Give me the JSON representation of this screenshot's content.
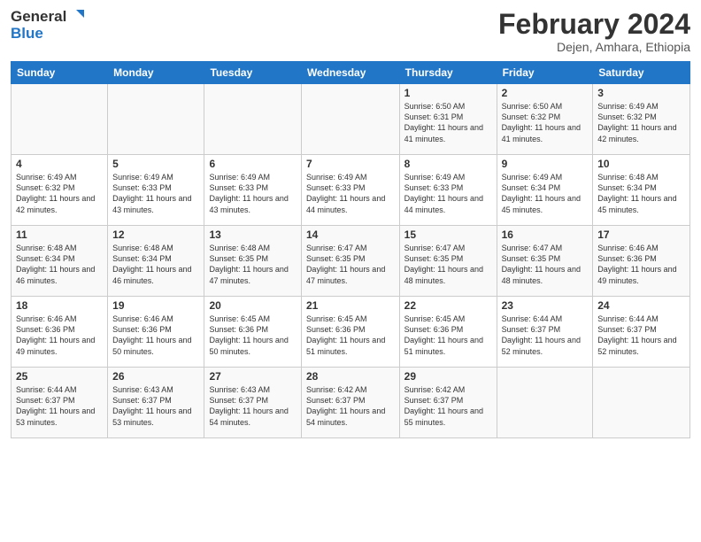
{
  "header": {
    "logo": {
      "general": "General",
      "blue": "Blue"
    },
    "month_year": "February 2024",
    "location": "Dejen, Amhara, Ethiopia"
  },
  "days_of_week": [
    "Sunday",
    "Monday",
    "Tuesday",
    "Wednesday",
    "Thursday",
    "Friday",
    "Saturday"
  ],
  "weeks": [
    [
      {
        "day": "",
        "info": ""
      },
      {
        "day": "",
        "info": ""
      },
      {
        "day": "",
        "info": ""
      },
      {
        "day": "",
        "info": ""
      },
      {
        "day": "1",
        "info": "Sunrise: 6:50 AM\nSunset: 6:31 PM\nDaylight: 11 hours and 41 minutes."
      },
      {
        "day": "2",
        "info": "Sunrise: 6:50 AM\nSunset: 6:32 PM\nDaylight: 11 hours and 41 minutes."
      },
      {
        "day": "3",
        "info": "Sunrise: 6:49 AM\nSunset: 6:32 PM\nDaylight: 11 hours and 42 minutes."
      }
    ],
    [
      {
        "day": "4",
        "info": "Sunrise: 6:49 AM\nSunset: 6:32 PM\nDaylight: 11 hours and 42 minutes."
      },
      {
        "day": "5",
        "info": "Sunrise: 6:49 AM\nSunset: 6:33 PM\nDaylight: 11 hours and 43 minutes."
      },
      {
        "day": "6",
        "info": "Sunrise: 6:49 AM\nSunset: 6:33 PM\nDaylight: 11 hours and 43 minutes."
      },
      {
        "day": "7",
        "info": "Sunrise: 6:49 AM\nSunset: 6:33 PM\nDaylight: 11 hours and 44 minutes."
      },
      {
        "day": "8",
        "info": "Sunrise: 6:49 AM\nSunset: 6:33 PM\nDaylight: 11 hours and 44 minutes."
      },
      {
        "day": "9",
        "info": "Sunrise: 6:49 AM\nSunset: 6:34 PM\nDaylight: 11 hours and 45 minutes."
      },
      {
        "day": "10",
        "info": "Sunrise: 6:48 AM\nSunset: 6:34 PM\nDaylight: 11 hours and 45 minutes."
      }
    ],
    [
      {
        "day": "11",
        "info": "Sunrise: 6:48 AM\nSunset: 6:34 PM\nDaylight: 11 hours and 46 minutes."
      },
      {
        "day": "12",
        "info": "Sunrise: 6:48 AM\nSunset: 6:34 PM\nDaylight: 11 hours and 46 minutes."
      },
      {
        "day": "13",
        "info": "Sunrise: 6:48 AM\nSunset: 6:35 PM\nDaylight: 11 hours and 47 minutes."
      },
      {
        "day": "14",
        "info": "Sunrise: 6:47 AM\nSunset: 6:35 PM\nDaylight: 11 hours and 47 minutes."
      },
      {
        "day": "15",
        "info": "Sunrise: 6:47 AM\nSunset: 6:35 PM\nDaylight: 11 hours and 48 minutes."
      },
      {
        "day": "16",
        "info": "Sunrise: 6:47 AM\nSunset: 6:35 PM\nDaylight: 11 hours and 48 minutes."
      },
      {
        "day": "17",
        "info": "Sunrise: 6:46 AM\nSunset: 6:36 PM\nDaylight: 11 hours and 49 minutes."
      }
    ],
    [
      {
        "day": "18",
        "info": "Sunrise: 6:46 AM\nSunset: 6:36 PM\nDaylight: 11 hours and 49 minutes."
      },
      {
        "day": "19",
        "info": "Sunrise: 6:46 AM\nSunset: 6:36 PM\nDaylight: 11 hours and 50 minutes."
      },
      {
        "day": "20",
        "info": "Sunrise: 6:45 AM\nSunset: 6:36 PM\nDaylight: 11 hours and 50 minutes."
      },
      {
        "day": "21",
        "info": "Sunrise: 6:45 AM\nSunset: 6:36 PM\nDaylight: 11 hours and 51 minutes."
      },
      {
        "day": "22",
        "info": "Sunrise: 6:45 AM\nSunset: 6:36 PM\nDaylight: 11 hours and 51 minutes."
      },
      {
        "day": "23",
        "info": "Sunrise: 6:44 AM\nSunset: 6:37 PM\nDaylight: 11 hours and 52 minutes."
      },
      {
        "day": "24",
        "info": "Sunrise: 6:44 AM\nSunset: 6:37 PM\nDaylight: 11 hours and 52 minutes."
      }
    ],
    [
      {
        "day": "25",
        "info": "Sunrise: 6:44 AM\nSunset: 6:37 PM\nDaylight: 11 hours and 53 minutes."
      },
      {
        "day": "26",
        "info": "Sunrise: 6:43 AM\nSunset: 6:37 PM\nDaylight: 11 hours and 53 minutes."
      },
      {
        "day": "27",
        "info": "Sunrise: 6:43 AM\nSunset: 6:37 PM\nDaylight: 11 hours and 54 minutes."
      },
      {
        "day": "28",
        "info": "Sunrise: 6:42 AM\nSunset: 6:37 PM\nDaylight: 11 hours and 54 minutes."
      },
      {
        "day": "29",
        "info": "Sunrise: 6:42 AM\nSunset: 6:37 PM\nDaylight: 11 hours and 55 minutes."
      },
      {
        "day": "",
        "info": ""
      },
      {
        "day": "",
        "info": ""
      }
    ]
  ]
}
